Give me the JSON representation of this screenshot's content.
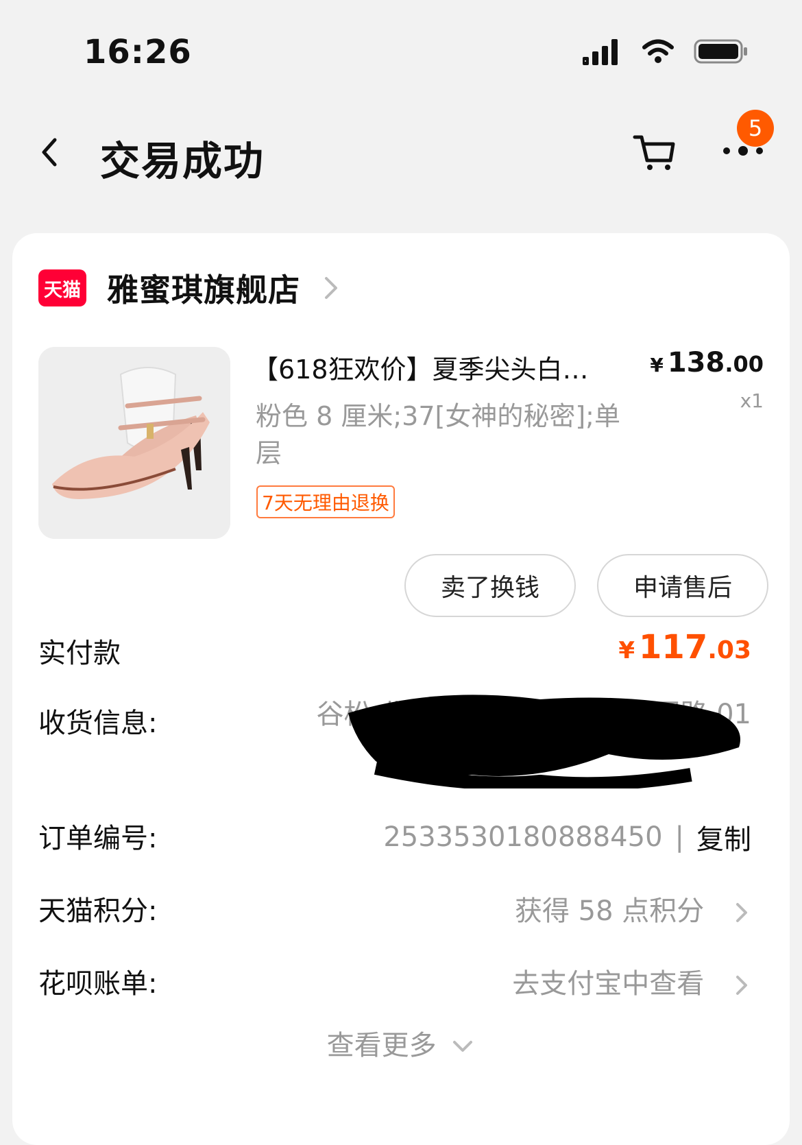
{
  "status": {
    "time": "16:26"
  },
  "nav": {
    "title": "交易成功",
    "badge_count": "5"
  },
  "shop": {
    "logo_text": "天猫",
    "name": "雅蜜琪旗舰店"
  },
  "product": {
    "title": "【618狂欢价】夏季尖头白…",
    "price_symbol": "¥",
    "price_int": "138",
    "price_dec": ".00",
    "quantity": "x1",
    "spec": "粉色 8 厘米;37[女神的秘密];单层",
    "return_tag": "7天无理由退换"
  },
  "actions": {
    "sell_label": "卖了换钱",
    "aftersale_label": "申请售后"
  },
  "details": {
    "paid_label": "实付款",
    "paid_symbol": "¥",
    "paid_int": "117",
    "paid_dec": ".03",
    "address_label": "收货信息:",
    "address_value": "谷松 北京 北京市 朝阳区 花园路 01",
    "order_label": "订单编号:",
    "order_number": "2533530180888450",
    "order_sep": "|",
    "copy_label": "复制",
    "points_label": "天猫积分:",
    "points_value": "获得 58 点积分",
    "huabei_label": "花呗账单:",
    "huabei_value": "去支付宝中查看",
    "more_label": "查看更多"
  },
  "colors": {
    "accent": "#ff5000",
    "tmall_red": "#ff0036",
    "badge": "#ff5a00"
  }
}
